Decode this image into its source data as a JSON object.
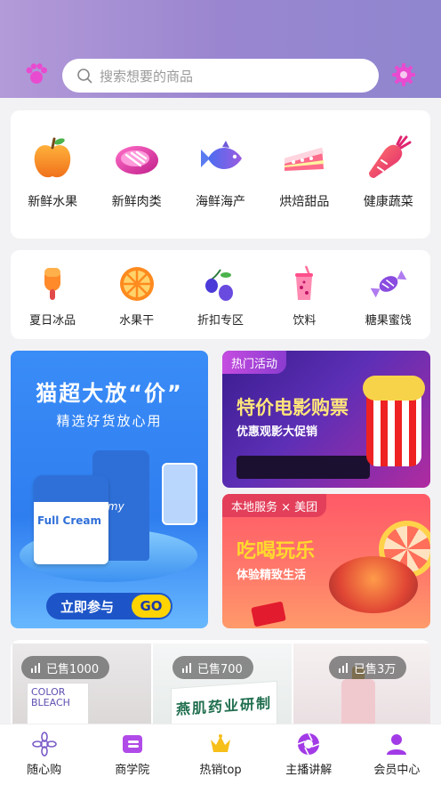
{
  "search": {
    "placeholder": "搜索想要的商品"
  },
  "categories_main": [
    {
      "label": "新鲜水果",
      "icon": "apple-icon"
    },
    {
      "label": "新鲜肉类",
      "icon": "meat-icon"
    },
    {
      "label": "海鲜海产",
      "icon": "fish-icon"
    },
    {
      "label": "烘焙甜品",
      "icon": "cake-icon"
    },
    {
      "label": "健康蔬菜",
      "icon": "carrot-icon"
    }
  ],
  "categories_sub": [
    {
      "label": "夏日冰品",
      "icon": "popsicle-icon"
    },
    {
      "label": "水果干",
      "icon": "orange-slice-icon"
    },
    {
      "label": "折扣专区",
      "icon": "olive-icon"
    },
    {
      "label": "饮料",
      "icon": "drink-icon"
    },
    {
      "label": "糖果蜜饯",
      "icon": "candy-icon"
    }
  ],
  "banner_left": {
    "title": "猫超大放“价”",
    "subtitle": "精选好货放心用",
    "can_label": "Full Cream",
    "bag_label": "Jamy",
    "cta": "立即参与",
    "go": "GO"
  },
  "banner_right_top": {
    "tag": "热门活动",
    "title": "特价电影购票",
    "subtitle": "优惠观影大促销"
  },
  "banner_right_bottom": {
    "tag": "本地服务 × 美团",
    "title": "吃喝玩乐",
    "subtitle": "体验精致生活"
  },
  "products": [
    {
      "sold": "已售1000",
      "box_text": "COLOR BLEACH"
    },
    {
      "sold": "已售700",
      "box_text": "燕肌药业研制"
    },
    {
      "sold": "已售3万"
    }
  ],
  "tabbar": [
    {
      "label": "随心购",
      "icon": "flower-icon",
      "color": "#7b5cc9"
    },
    {
      "label": "商学院",
      "icon": "book-icon",
      "color": "#9b2be0"
    },
    {
      "label": "热销top",
      "icon": "crown-icon",
      "color": "#f2b400"
    },
    {
      "label": "主播讲解",
      "icon": "camera-aperture-icon",
      "color": "#9b2be0"
    },
    {
      "label": "会员中心",
      "icon": "user-icon",
      "color": "#9b2be0"
    }
  ],
  "colors": {
    "header_start": "#b39ad8",
    "header_end": "#8f86cf",
    "accent": "#9b2be0"
  }
}
